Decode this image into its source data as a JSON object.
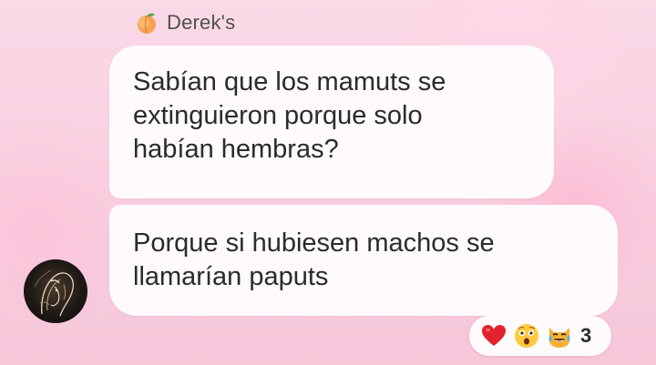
{
  "chat": {
    "sender": {
      "name": "Derek's",
      "badge_icon": "peach-icon"
    },
    "messages": [
      {
        "lines": [
          "Sabían que los mamuts se",
          "extinguieron porque solo",
          "habían hembras?"
        ]
      },
      {
        "lines": [
          "Porque si hubiesen machos se",
          "llamarían paputs"
        ]
      }
    ],
    "reactions": {
      "icons": [
        "red-heart-icon",
        "astonished-face-icon",
        "crying-laughing-cat-icon"
      ],
      "count": "3"
    }
  },
  "colors": {
    "bubble": "#fffafc",
    "background": "#f8cfe0",
    "text": "#2b2b2b",
    "sender_text": "#505050"
  }
}
